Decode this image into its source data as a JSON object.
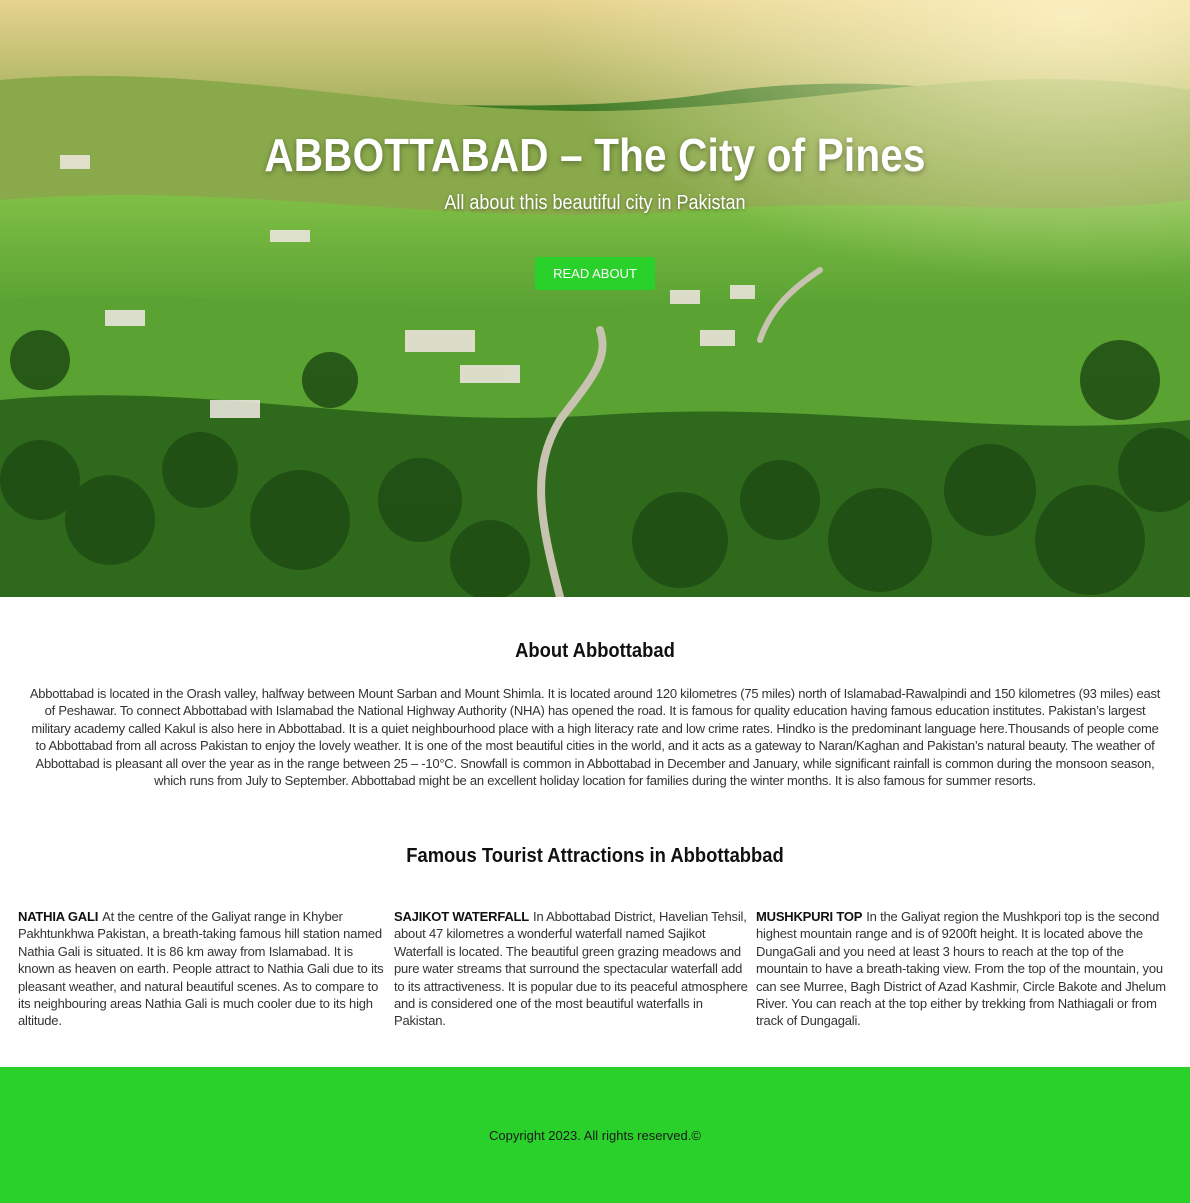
{
  "hero": {
    "title": "ABBOTTABAD – The City of Pines",
    "subtitle": "All about this beautiful city in Pakistan",
    "button_label": "READ ABOUT"
  },
  "about": {
    "heading": "About Abbottabad",
    "text": "Abbottabad is located in the Orash valley, halfway between Mount Sarban and Mount Shimla. It is located around 120 kilometres (75 miles) north of Islamabad-Rawalpindi and 150 kilometres (93 miles) east of Peshawar. To connect Abbottabad with Islamabad the National Highway Authority (NHA) has opened the road. It is famous for quality education having famous education institutes. Pakistan’s largest military academy called Kakul is also here in Abbottabad. It is a quiet neighbourhood place with a high literacy rate and low crime rates. Hindko is the predominant language here.Thousands of people come to Abbottabad from all across Pakistan to enjoy the lovely weather. It is one of the most beautiful cities in the world, and it acts as a gateway to Naran/Kaghan and Pakistan’s natural beauty. The weather of Abbottabad is pleasant all over the year as in the range between 25 – -10°C. Snowfall is common in Abbottabad in December and January, while significant rainfall is common during the monsoon season, which runs from July to September. Abbottabad might be an excellent holiday location for families during the winter months. It is also famous for summer resorts."
  },
  "attractions": {
    "heading": "Famous Tourist Attractions in Abbottabbad",
    "items": [
      {
        "name": "NATHIA GALI",
        "text": "At the centre of the Galiyat range in Khyber Pakhtunkhwa Pakistan, a breath-taking famous hill station named Nathia Gali is situated. It is 86 km away from Islamabad. It is known as heaven on earth. People attract to Nathia Gali due to its pleasant weather, and natural beautiful scenes. As to compare to its neighbouring areas Nathia Gali is much cooler due to its high altitude."
      },
      {
        "name": "SAJIKOT WATERFALL",
        "text": "In Abbottabad District, Havelian Tehsil, about 47 kilometres a wonderful waterfall named Sajikot Waterfall is located. The beautiful green grazing meadows and pure water streams that surround the spectacular waterfall add to its attractiveness. It is popular due to its peaceful atmosphere and is considered one of the most beautiful waterfalls in Pakistan."
      },
      {
        "name": "MUSHKPURI TOP",
        "text": "In the Galiyat region the Mushkpori top is the second highest mountain range and is of 9200ft height. It is located above the DungaGali and you need at least 3 hours to reach at the top of the mountain to have a breath-taking view. From the top of the mountain, you can see Murree, Bagh District of Azad Kashmir, Circle Bakote and Jhelum River. You can reach at the top either by trekking from Nathiagali or from track of Dungagali."
      }
    ]
  },
  "footer": {
    "copyright": "Copyright 2023. All rights reserved.©"
  },
  "colors": {
    "accent_green": "#2bd12b",
    "hero_overlay_text": "#ffffff"
  }
}
